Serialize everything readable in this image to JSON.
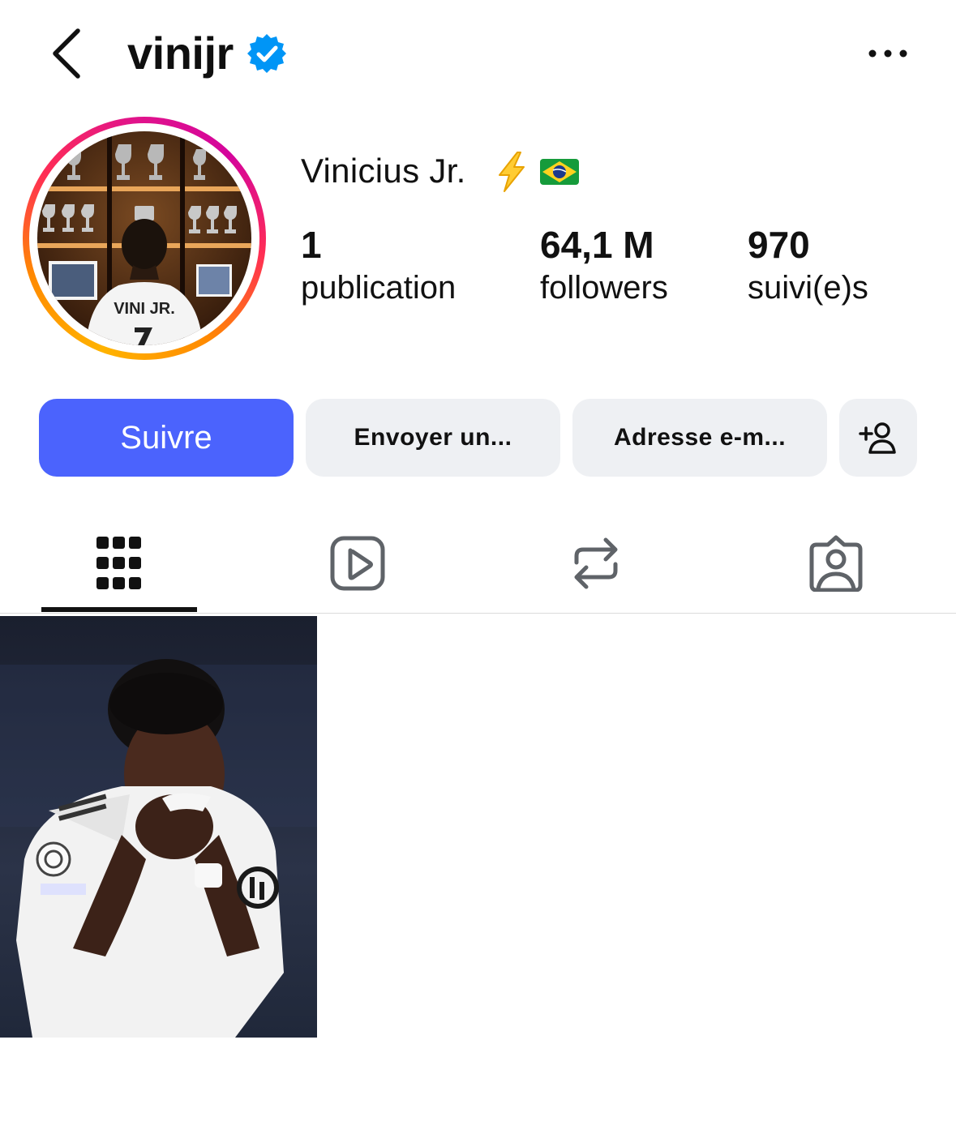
{
  "header": {
    "username": "vinijr",
    "back_icon": "chevron-left-icon",
    "verified_icon": "verified-badge-icon",
    "more_icon": "more-horizontal-icon"
  },
  "profile": {
    "display_name": "Vinicius Jr.",
    "name_emojis": [
      "lightning-emoji",
      "brazil-flag-emoji"
    ],
    "stats": [
      {
        "value": "1",
        "label": "publication"
      },
      {
        "value": "64,1 M",
        "label": "followers"
      },
      {
        "value": "970",
        "label": "suivi(e)s"
      }
    ],
    "avatar_jersey_text": "VINI JR."
  },
  "actions": {
    "follow_label": "Suivre",
    "message_label": "Envoyer un...",
    "email_label": "Adresse e-m...",
    "add_user_icon": "add-user-icon"
  },
  "tabs": [
    {
      "name": "grid",
      "icon": "grid-icon",
      "active": true
    },
    {
      "name": "reels",
      "icon": "reels-icon",
      "active": false
    },
    {
      "name": "reposts",
      "icon": "repost-icon",
      "active": false
    },
    {
      "name": "tagged",
      "icon": "tagged-icon",
      "active": false
    }
  ],
  "colors": {
    "follow_button": "#4b63fd",
    "gray_button": "#eef0f3",
    "verified_blue": "#0095f6",
    "icon_gray": "#5f6368"
  },
  "posts": [
    {
      "alt": "player-photo"
    }
  ]
}
